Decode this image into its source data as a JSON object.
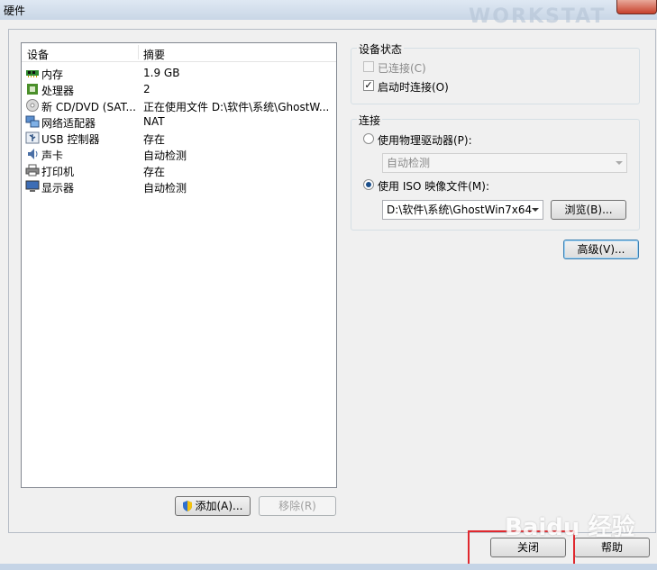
{
  "window": {
    "title": "硬件",
    "faded_title": "WORKSTAT"
  },
  "devices": {
    "headers": {
      "device": "设备",
      "summary": "摘要"
    },
    "rows": [
      {
        "icon": "memory-icon",
        "name": "内存",
        "summary": "1.9 GB"
      },
      {
        "icon": "processor-icon",
        "name": "处理器",
        "summary": "2"
      },
      {
        "icon": "cd-dvd-icon",
        "name": "新 CD/DVD (SAT...",
        "summary": "正在使用文件 D:\\软件\\系统\\GhostW..."
      },
      {
        "icon": "network-adapter-icon",
        "name": "网络适配器",
        "summary": "NAT"
      },
      {
        "icon": "usb-controller-icon",
        "name": "USB 控制器",
        "summary": "存在"
      },
      {
        "icon": "sound-card-icon",
        "name": "声卡",
        "summary": "自动检测"
      },
      {
        "icon": "printer-icon",
        "name": "打印机",
        "summary": "存在"
      },
      {
        "icon": "display-icon",
        "name": "显示器",
        "summary": "自动检测"
      }
    ],
    "add_button": "添加(A)...",
    "remove_button": "移除(R)"
  },
  "device_status": {
    "label": "设备状态",
    "connected": "已连接(C)",
    "connect_at_power_on": "启动时连接(O)"
  },
  "connection": {
    "label": "连接",
    "physical_drive": "使用物理驱动器(P):",
    "physical_drive_value": "自动检测",
    "iso_image": "使用 ISO 映像文件(M):",
    "iso_path": "D:\\软件\\系统\\GhostWin7x64",
    "browse_button": "浏览(B)...",
    "advanced_button": "高级(V)..."
  },
  "footer": {
    "close_button": "关闭",
    "help_button": "帮助",
    "watermark": "Baidu 经验"
  },
  "colors": {
    "highlight_box": "#e0282e",
    "accent": "#3c7fb1"
  }
}
